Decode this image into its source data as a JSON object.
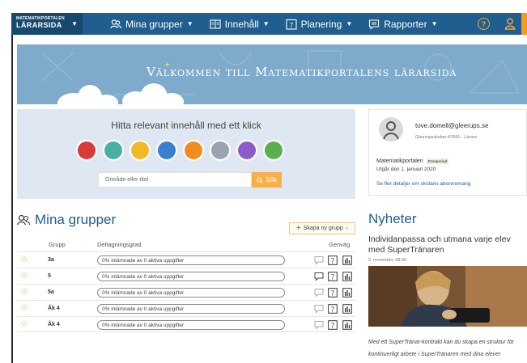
{
  "brand": {
    "small": "MATEMATIKPORTALEN",
    "big": "LÄRARSIDA"
  },
  "nav": {
    "items": [
      {
        "label": "Mina grupper"
      },
      {
        "label": "Innehåll"
      },
      {
        "label": "Planering",
        "icon_text": "7"
      },
      {
        "label": "Rapporter"
      }
    ],
    "help": "?"
  },
  "hero": {
    "title": "Välkommen till Matematikportalens lärarsida"
  },
  "search": {
    "title": "Hitta relevant innehåll med ett klick",
    "placeholder": "Område eller titel",
    "button": "Sök",
    "category_icons": [
      "#d63a3a",
      "#48b0a0",
      "#f0b92c",
      "#3a7fd0",
      "#f08c1e",
      "#9aa3b0",
      "#8d5bc7",
      "#5caf4e"
    ]
  },
  "profile": {
    "email": "tove.domell@gleerups.se",
    "school": "Gleerupsskolan-47681 - Lärare",
    "product": "Matematikportalen",
    "trial_badge": "Provperiod",
    "expires": "Utgår den 1. januari 2020",
    "link": "Se fler detaljer om skolans abonnemang"
  },
  "groups": {
    "heading": "Mina grupper",
    "new_button": "Skapa ny grupp",
    "columns": {
      "group": "Grupp",
      "participation": "Deltagningsgrad",
      "shortcut": "Genväg"
    },
    "rows": [
      {
        "name": "3a",
        "progress": "0% inlämnade av 0 aktiva uppgifter"
      },
      {
        "name": "5",
        "progress": "0% inlämnade av 0 aktiva uppgifter"
      },
      {
        "name": "5a",
        "progress": "0% inlämnade av 0 aktiva uppgifter"
      },
      {
        "name": "Åk 4",
        "progress": "0% inlämnade av 0 aktiva uppgifter"
      },
      {
        "name": "Åk 4",
        "progress": "0% inlämnade av 0 aktiva uppgifter"
      }
    ],
    "calendar_glyph": "7"
  },
  "news": {
    "heading": "Nyheter",
    "title": "Individanpassa och utmana varje elev med SuperTränaren",
    "date": "2. november, 08:00",
    "text": "Med ett SuperTränar-kontrakt kan du skapa en struktur för kontinuerligt arbete i SuperTränaren med dina elever"
  },
  "colors": {
    "nav": "#1f5e8e",
    "accent": "#f39a1f",
    "hero": "#7eaacb",
    "panel": "#dfe8f2"
  }
}
